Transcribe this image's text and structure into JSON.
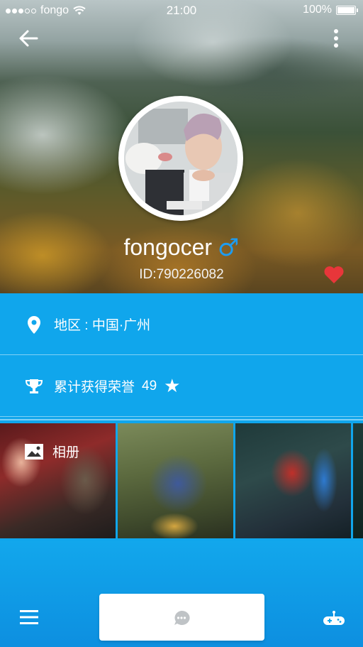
{
  "status_bar": {
    "carrier": "fongo",
    "time": "21:00",
    "battery": "100%"
  },
  "profile": {
    "username": "fongocer",
    "gender_symbol": "♂",
    "user_id": "ID:790226082"
  },
  "location": {
    "text": "地区 : 中国·广州",
    "icon": "location-pin-icon"
  },
  "honor": {
    "label": "累计获得荣誉",
    "count": "49",
    "star": "★",
    "icon": "trophy-icon"
  },
  "album": {
    "label": "相册",
    "icon": "image-icon"
  },
  "colors": {
    "primary": "#10a6ec",
    "gender": "#1e9cf0",
    "heart": "#e8363a"
  }
}
